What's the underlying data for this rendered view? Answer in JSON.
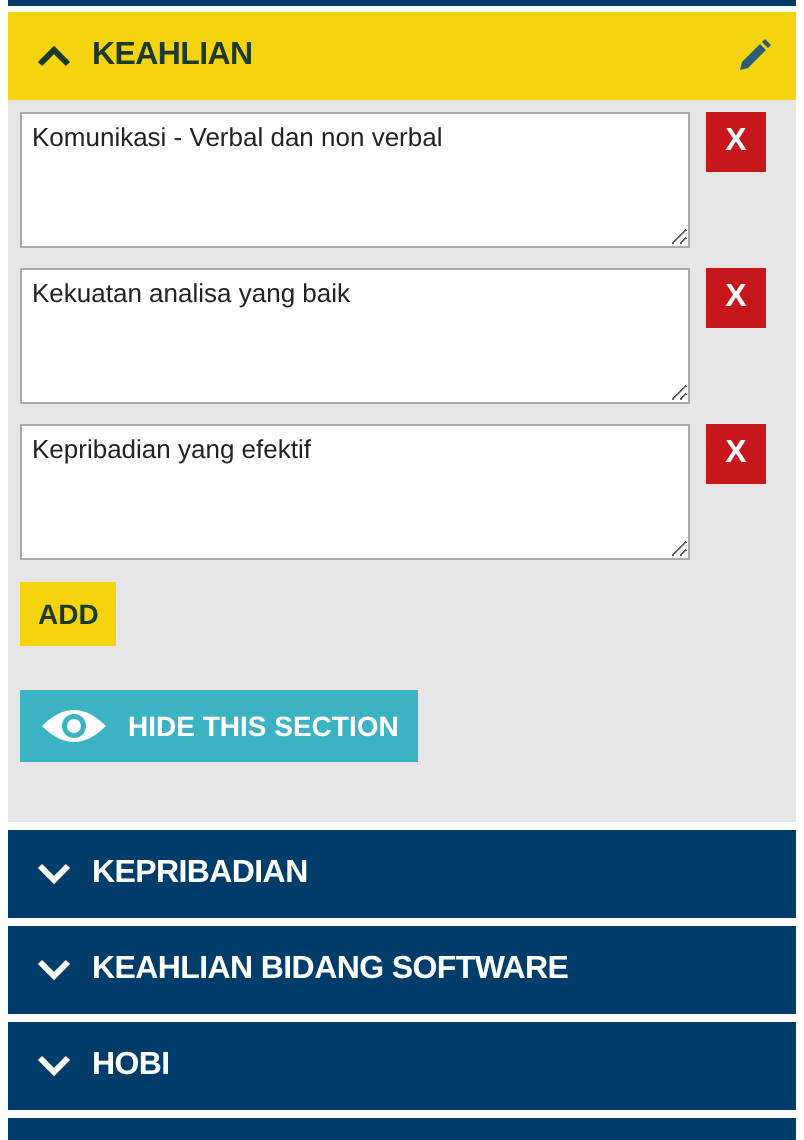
{
  "sections": [
    {
      "title": "KEAHLIAN",
      "expanded": true,
      "items": [
        {
          "text": "Komunikasi - Verbal dan non verbal",
          "remove_label": "X"
        },
        {
          "text": "Kekuatan analisa yang baik",
          "remove_label": "X"
        },
        {
          "text": "Kepribadian yang efektif",
          "remove_label": "X"
        }
      ],
      "add_label": "ADD",
      "hide_label": "HIDE THIS SECTION"
    },
    {
      "title": "KEPRIBADIAN",
      "expanded": false
    },
    {
      "title": "KEAHLIAN BIDANG SOFTWARE",
      "expanded": false
    },
    {
      "title": "HOBI",
      "expanded": false
    },
    {
      "expanded": false
    }
  ]
}
